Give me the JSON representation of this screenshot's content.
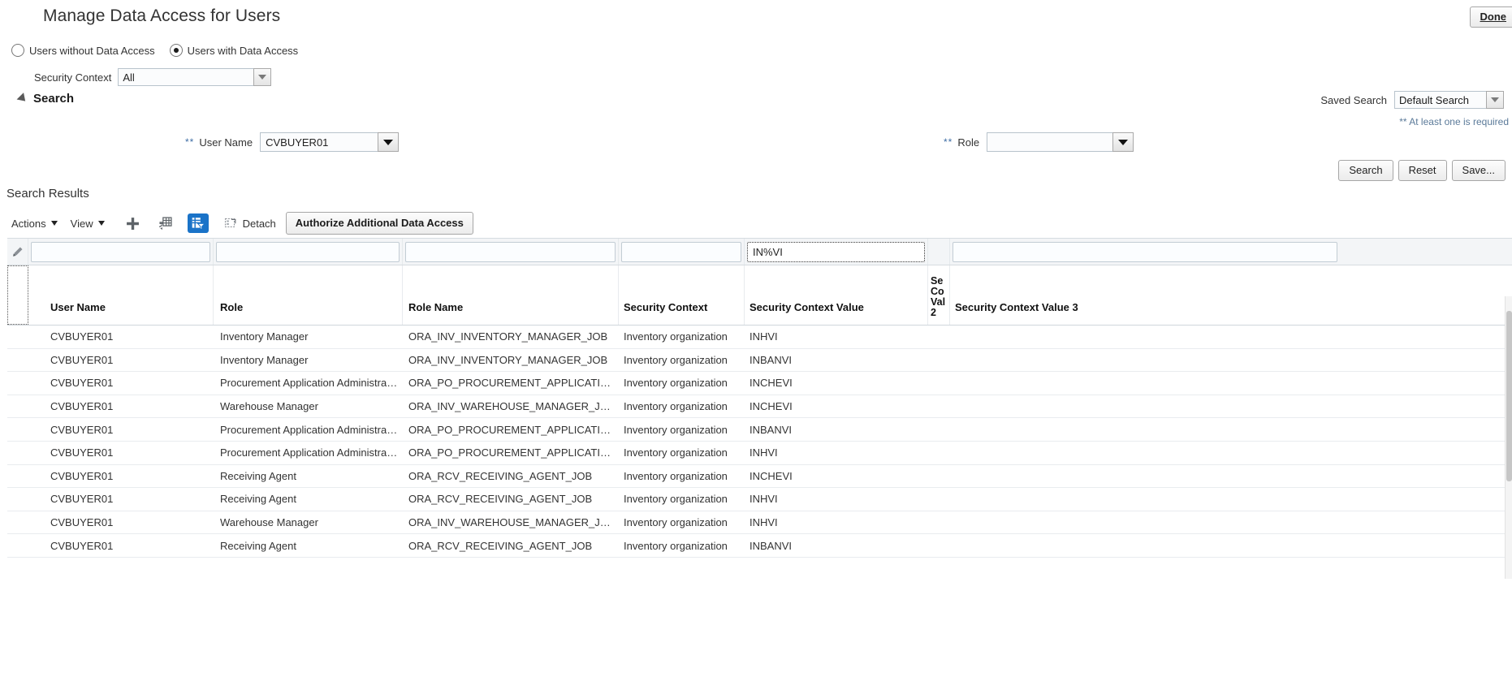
{
  "header": {
    "title": "Manage Data Access for Users",
    "done_label": "Done"
  },
  "access_filter": {
    "without_label": "Users without Data Access",
    "with_label": "Users with Data Access",
    "selected": "Users with Data Access"
  },
  "security_context": {
    "label": "Security Context",
    "value": "All",
    "icon": "chevron-down-icon"
  },
  "search_panel": {
    "title": "Search",
    "disclosure_icon": "triangle-collapse-icon",
    "saved_search_label": "Saved Search",
    "saved_search_value": "Default Search",
    "required_note": "** At least one is required",
    "required_marker": "**",
    "user_name_label": "User Name",
    "user_name_value": "CVBUYER01",
    "role_label": "Role",
    "role_value": "",
    "lov_icon": "dropdown-caret-icon",
    "buttons": {
      "search": "Search",
      "reset": "Reset",
      "save": "Save..."
    }
  },
  "results": {
    "title": "Search Results",
    "toolbar": {
      "actions_label": "Actions",
      "view_label": "View",
      "add_icon": "plus-icon",
      "columns_icon": "freeze-columns-icon",
      "query_icon": "query-by-example-icon",
      "detach_icon": "detach-icon",
      "detach_label": "Detach",
      "authorize_label": "Authorize Additional Data Access",
      "active_accent": "#1a73c8"
    },
    "filter_row": {
      "edit_icon": "pencil-edit-icon",
      "user_name_filter": "",
      "role_filter": "",
      "role_name_filter": "",
      "security_context_filter": "",
      "security_context_value_filter": "IN%VI",
      "security_context_value_3_filter": ""
    },
    "columns": [
      "User Name",
      "Role",
      "Role Name",
      "Security Context",
      "Security Context Value",
      "Se Co Val 2",
      "Security Context Value 3"
    ],
    "rows": [
      {
        "user_name": "CVBUYER01",
        "role": "Inventory Manager",
        "role_name": "ORA_INV_INVENTORY_MANAGER_JOB",
        "security_context": "Inventory organization",
        "security_context_value": "INHVI",
        "security_context_value_2": "",
        "security_context_value_3": ""
      },
      {
        "user_name": "CVBUYER01",
        "role": "Inventory Manager",
        "role_name": "ORA_INV_INVENTORY_MANAGER_JOB",
        "security_context": "Inventory organization",
        "security_context_value": "INBANVI",
        "security_context_value_2": "",
        "security_context_value_3": ""
      },
      {
        "user_name": "CVBUYER01",
        "role": "Procurement Application Administrator",
        "role_name": "ORA_PO_PROCUREMENT_APPLICATION_ADMI...",
        "security_context": "Inventory organization",
        "security_context_value": "INCHEVI",
        "security_context_value_2": "",
        "security_context_value_3": ""
      },
      {
        "user_name": "CVBUYER01",
        "role": "Warehouse Manager",
        "role_name": "ORA_INV_WAREHOUSE_MANAGER_JOB",
        "security_context": "Inventory organization",
        "security_context_value": "INCHEVI",
        "security_context_value_2": "",
        "security_context_value_3": ""
      },
      {
        "user_name": "CVBUYER01",
        "role": "Procurement Application Administrator",
        "role_name": "ORA_PO_PROCUREMENT_APPLICATION_ADMI...",
        "security_context": "Inventory organization",
        "security_context_value": "INBANVI",
        "security_context_value_2": "",
        "security_context_value_3": ""
      },
      {
        "user_name": "CVBUYER01",
        "role": "Procurement Application Administrator",
        "role_name": "ORA_PO_PROCUREMENT_APPLICATION_ADMI...",
        "security_context": "Inventory organization",
        "security_context_value": "INHVI",
        "security_context_value_2": "",
        "security_context_value_3": ""
      },
      {
        "user_name": "CVBUYER01",
        "role": "Receiving Agent",
        "role_name": "ORA_RCV_RECEIVING_AGENT_JOB",
        "security_context": "Inventory organization",
        "security_context_value": "INCHEVI",
        "security_context_value_2": "",
        "security_context_value_3": ""
      },
      {
        "user_name": "CVBUYER01",
        "role": "Receiving Agent",
        "role_name": "ORA_RCV_RECEIVING_AGENT_JOB",
        "security_context": "Inventory organization",
        "security_context_value": "INHVI",
        "security_context_value_2": "",
        "security_context_value_3": ""
      },
      {
        "user_name": "CVBUYER01",
        "role": "Warehouse Manager",
        "role_name": "ORA_INV_WAREHOUSE_MANAGER_JOB",
        "security_context": "Inventory organization",
        "security_context_value": "INHVI",
        "security_context_value_2": "",
        "security_context_value_3": ""
      },
      {
        "user_name": "CVBUYER01",
        "role": "Receiving Agent",
        "role_name": "ORA_RCV_RECEIVING_AGENT_JOB",
        "security_context": "Inventory organization",
        "security_context_value": "INBANVI",
        "security_context_value_2": "",
        "security_context_value_3": ""
      }
    ]
  },
  "colors": {
    "accent_blue": "#1a73c8",
    "link_blue": "#5b7a99",
    "border": "#b8c3cc",
    "row_border": "#e9ecef"
  }
}
